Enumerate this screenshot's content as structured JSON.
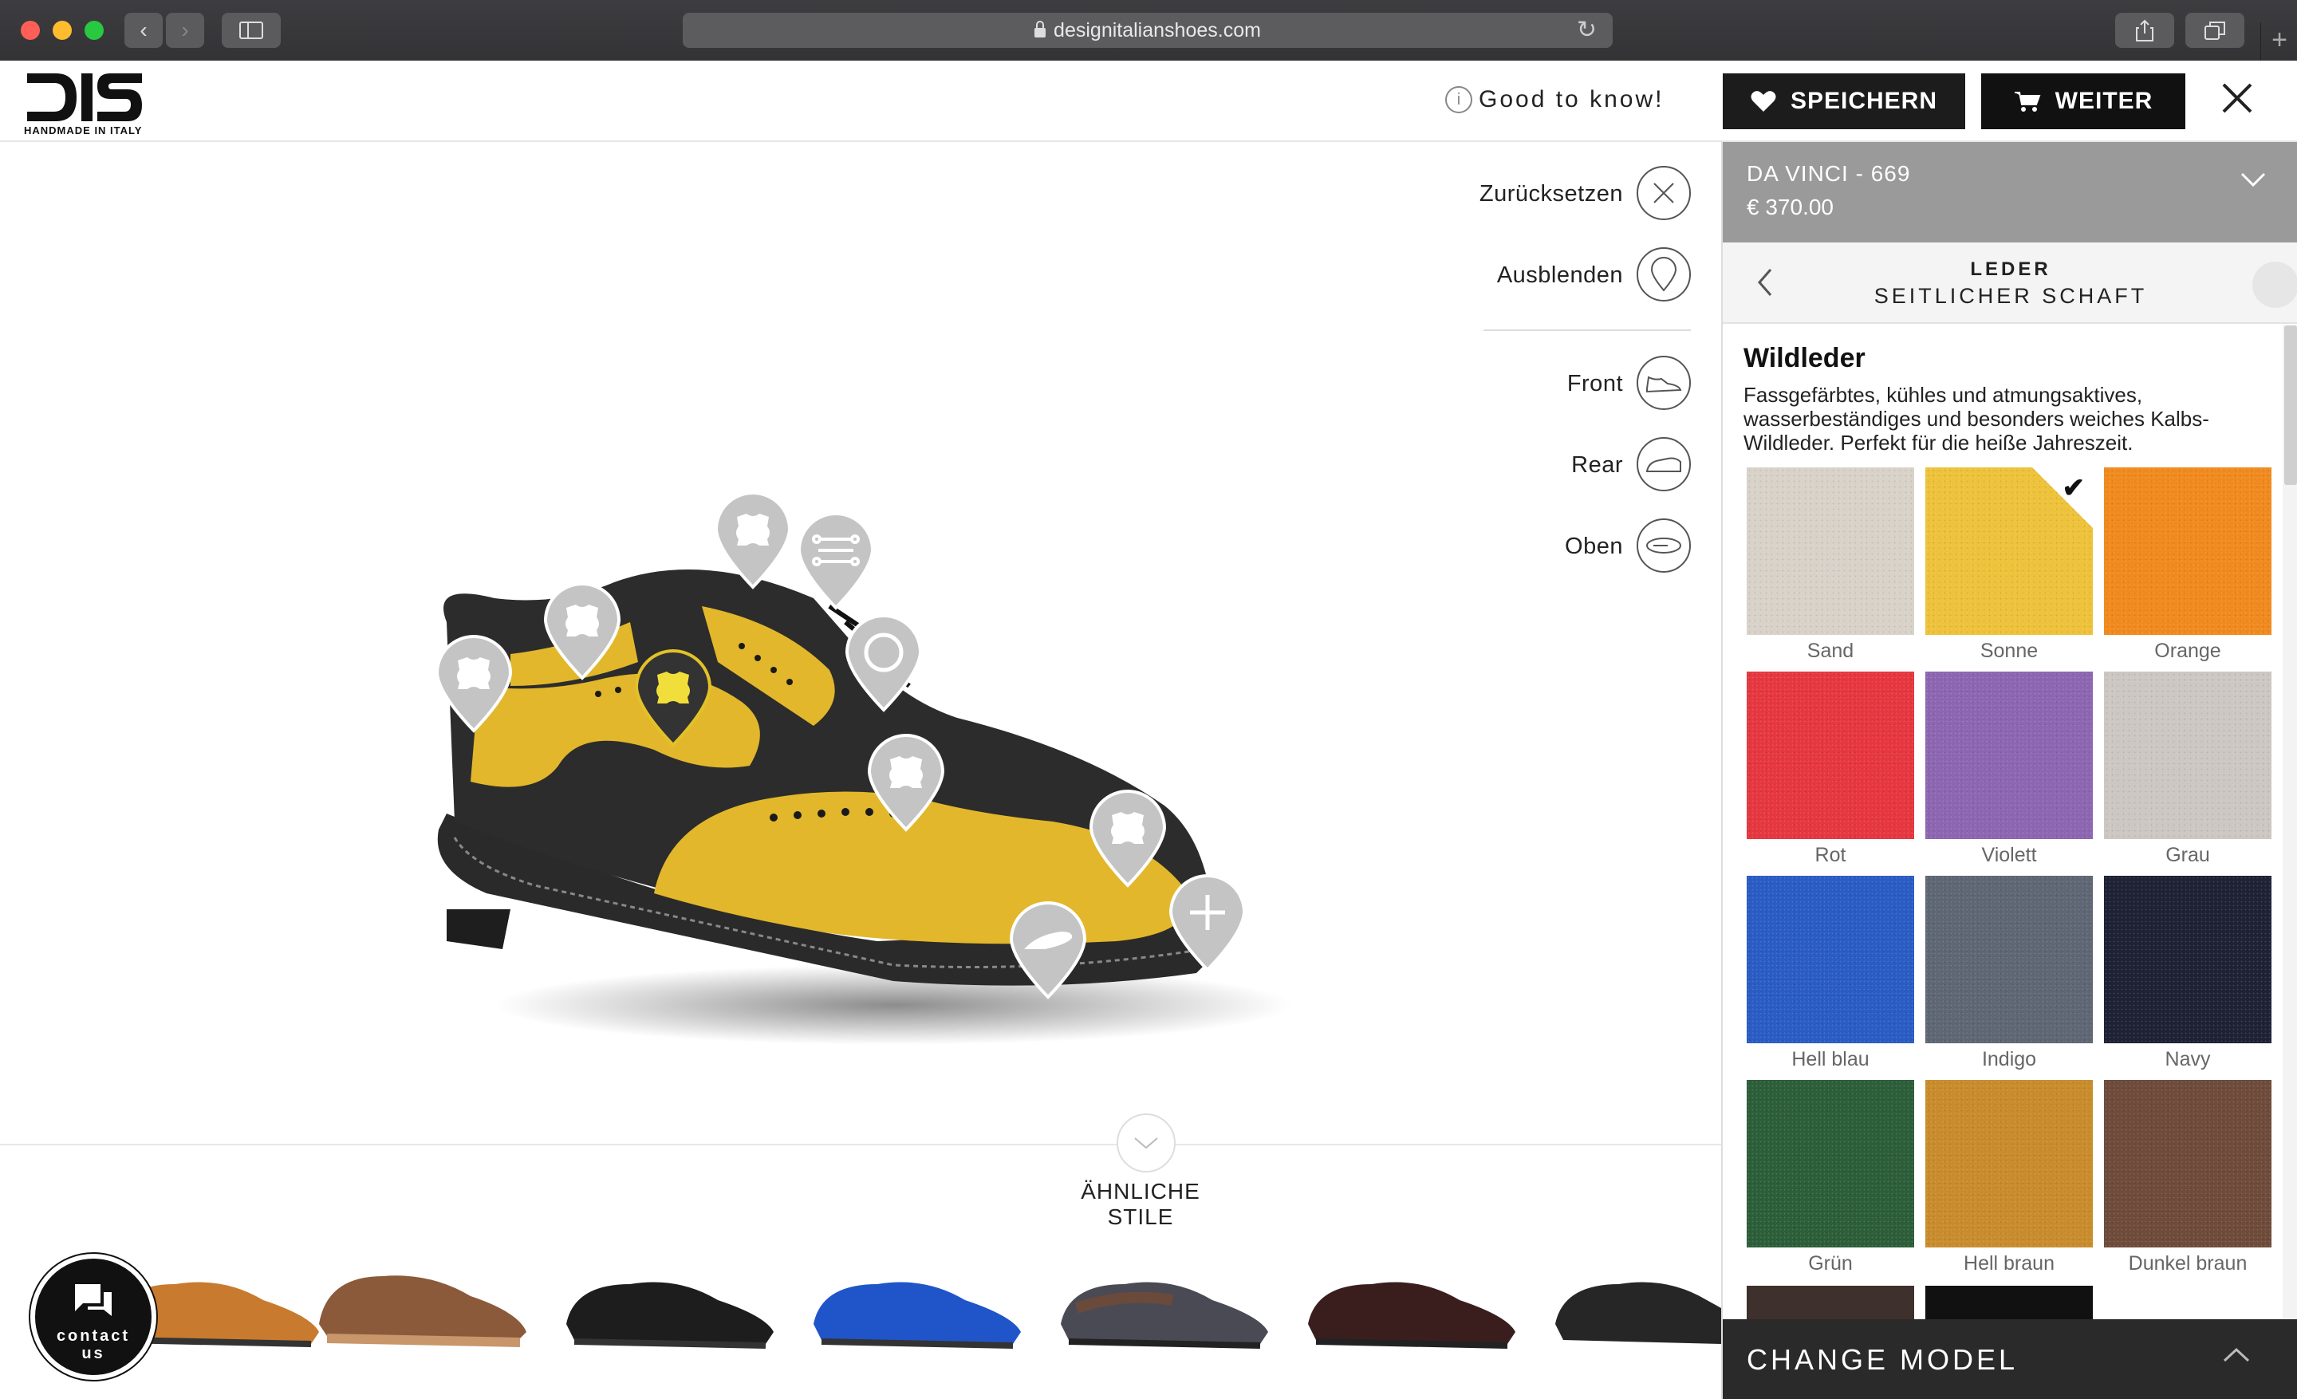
{
  "browser": {
    "url": "designitalianshoes.com"
  },
  "brand": {
    "tagline": "HANDMADE IN ITALY"
  },
  "header": {
    "good_to_know": "Good to know!",
    "save_label": "SPEICHERN",
    "next_label": "WEITER"
  },
  "controls": {
    "reset": "Zurücksetzen",
    "hide": "Ausblenden",
    "front": "Front",
    "rear": "Rear",
    "top": "Oben"
  },
  "similar": {
    "title": "ÄHNLICHE STILE"
  },
  "contact": {
    "line1": "contact",
    "line2": "us"
  },
  "panel": {
    "model_name": "DA VINCI - 669",
    "price": "€ 370.00",
    "section": "LEDER",
    "subsection": "SEITLICHER SCHAFT",
    "material_title": "Wildleder",
    "material_desc": "Fassgefärbtes, kühles und atmungsaktives, wasserbeständiges und besonders weiches Kalbs-Wildleder. Perfekt für die heiße Jahreszeit.",
    "swatches": [
      {
        "name": "Sand",
        "color": "#d8d2c9"
      },
      {
        "name": "Sonne",
        "color": "#eec23a",
        "selected": true
      },
      {
        "name": "Orange",
        "color": "#f18a1e"
      },
      {
        "name": "Rot",
        "color": "#e63740"
      },
      {
        "name": "Violett",
        "color": "#8d66b2"
      },
      {
        "name": "Grau",
        "color": "#ccc7c3"
      },
      {
        "name": "Hell blau",
        "color": "#2a5cc4"
      },
      {
        "name": "Indigo",
        "color": "#5f6674"
      },
      {
        "name": "Navy",
        "color": "#1f2235"
      },
      {
        "name": "Grün",
        "color": "#2d5e3a"
      },
      {
        "name": "Hell braun",
        "color": "#c98c2c"
      },
      {
        "name": "Dunkel braun",
        "color": "#6e4b3a"
      }
    ],
    "change_model": "CHANGE MODEL"
  }
}
